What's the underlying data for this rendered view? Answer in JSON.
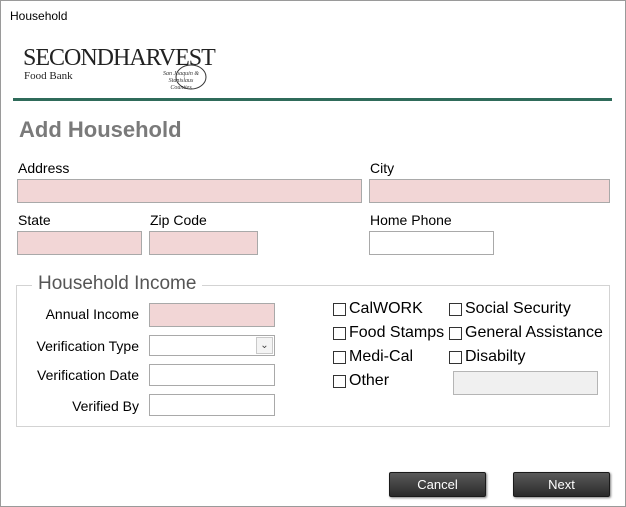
{
  "window": {
    "title": "Household"
  },
  "logo": {
    "main": "SECONDHARVEST",
    "sub": "Food Bank",
    "tag": "San Joaquin & Stanislaus Counties"
  },
  "page": {
    "title": "Add Household"
  },
  "address": {
    "label": "Address",
    "value": ""
  },
  "city": {
    "label": "City",
    "value": ""
  },
  "state": {
    "label": "State",
    "value": ""
  },
  "zip": {
    "label": "Zip Code",
    "value": ""
  },
  "home_phone": {
    "label": "Home Phone",
    "value": ""
  },
  "income": {
    "group_title": "Household Income",
    "annual_income_label": "Annual Income",
    "annual_income_value": "",
    "verification_type_label": "Verification Type",
    "verification_type_value": "",
    "verification_date_label": "Verification Date",
    "verification_date_value": "",
    "verified_by_label": "Verified By",
    "verified_by_value": "",
    "checkboxes": [
      {
        "label": "CalWORK",
        "checked": false
      },
      {
        "label": "Social Security",
        "checked": false
      },
      {
        "label": "Food Stamps",
        "checked": false
      },
      {
        "label": "General Assistance",
        "checked": false
      },
      {
        "label": "Medi-Cal",
        "checked": false
      },
      {
        "label": "Disabilty",
        "checked": false
      },
      {
        "label": "Other",
        "checked": false
      }
    ],
    "other_value": ""
  },
  "buttons": {
    "cancel": "Cancel",
    "next": "Next"
  },
  "colors": {
    "required_field": "#f2d6d6",
    "rule": "#2f6b5a",
    "title": "#7a7a7a"
  }
}
